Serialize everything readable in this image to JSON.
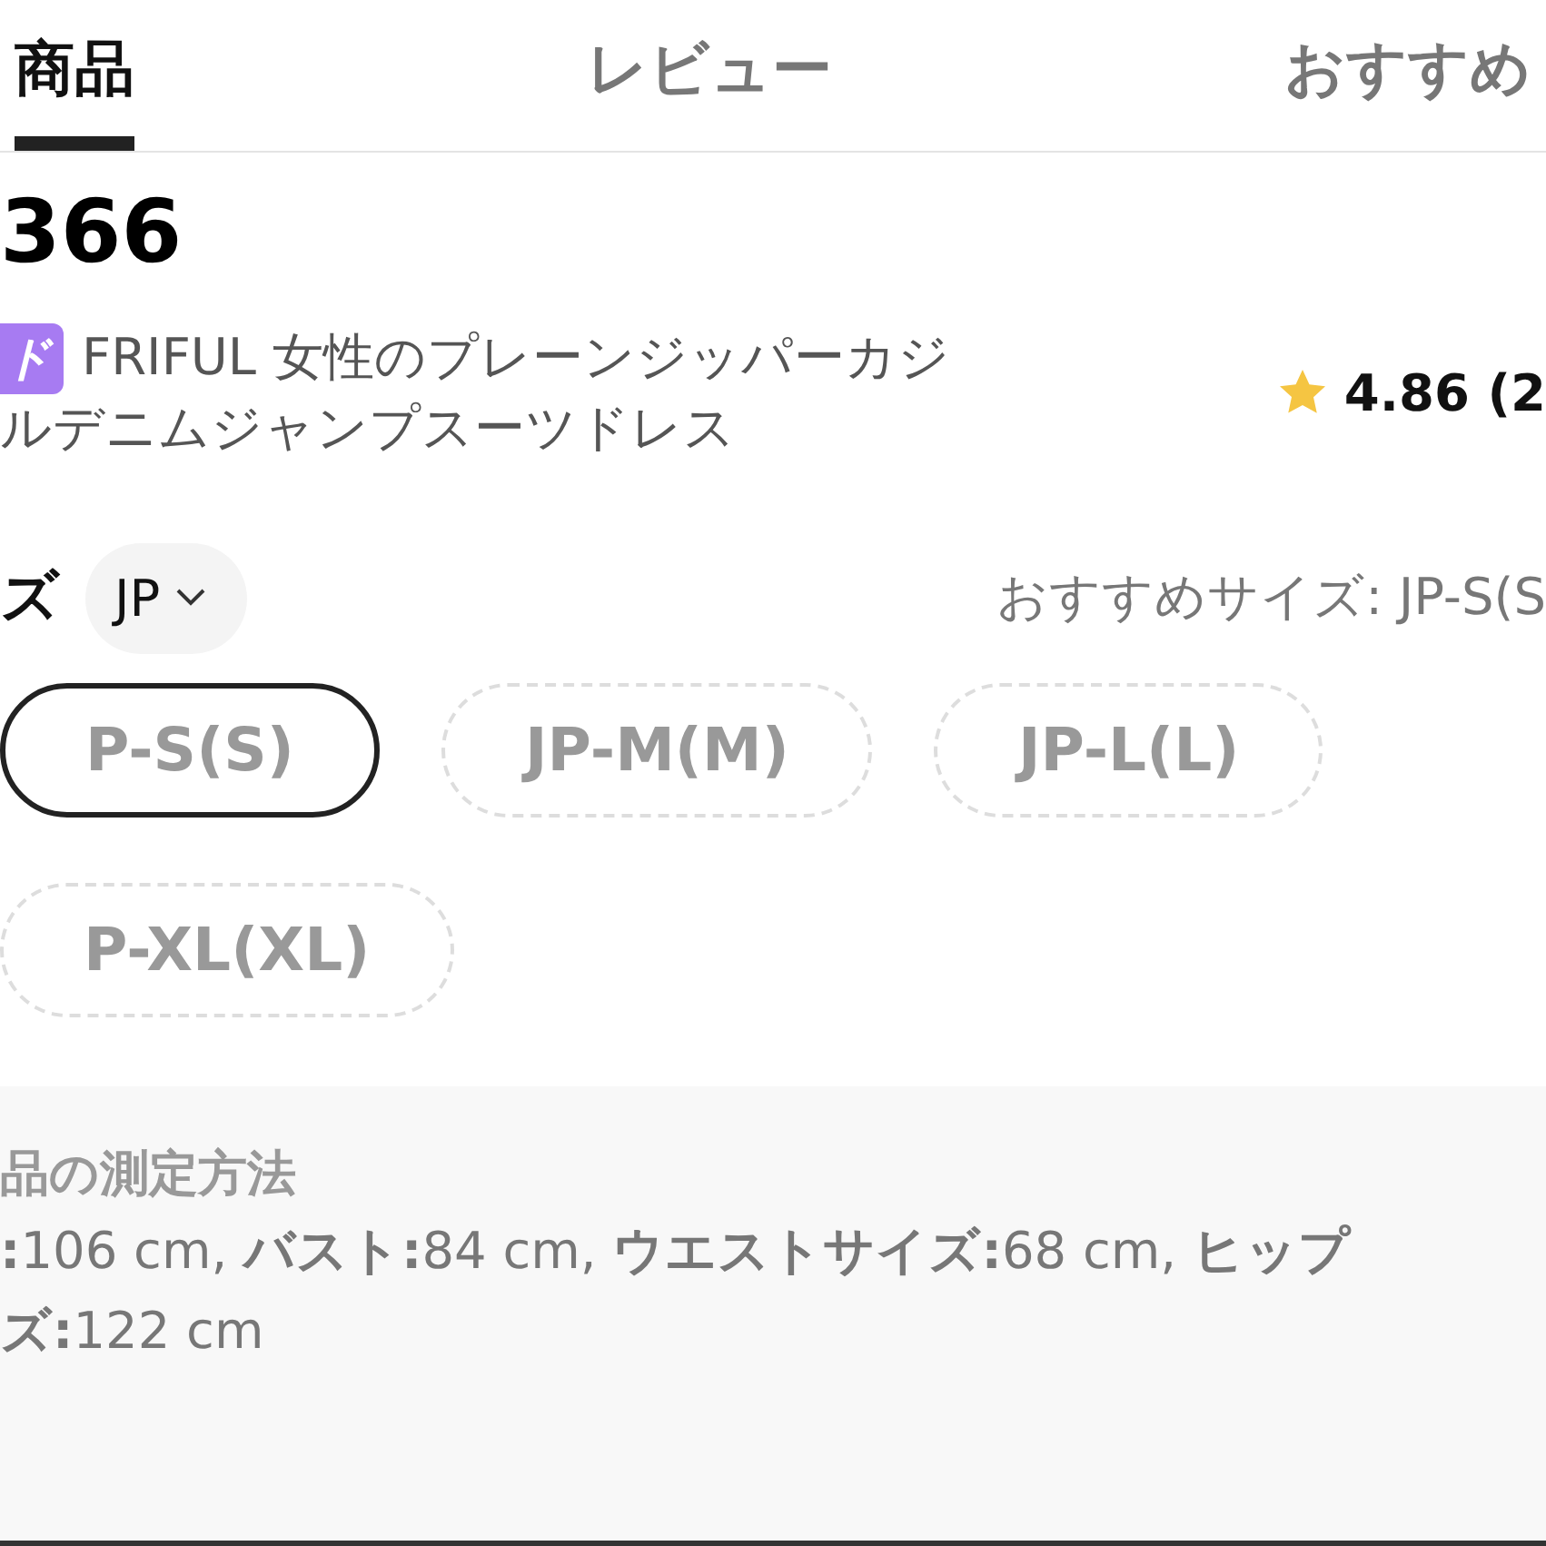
{
  "tabs": [
    {
      "label": "商品",
      "selected": true
    },
    {
      "label": "レビュー",
      "selected": false
    },
    {
      "label": "おすすめ",
      "selected": false
    }
  ],
  "price": "366",
  "product": {
    "badge": "ド",
    "title_lines": [
      "FRIFUL 女性のプレーンジッパーカジ",
      "ルデニムジャンプスーツドレス"
    ],
    "rating": "4.86 (2"
  },
  "size": {
    "label": "ズ",
    "region": "JP",
    "recommended": "おすすめサイズ: JP-S(S",
    "options": [
      {
        "label": "P-S(S)",
        "selected": true
      },
      {
        "label": "JP-M(M)",
        "selected": false
      },
      {
        "label": "JP-L(L)",
        "selected": false
      },
      {
        "label": "P-XL(XL)",
        "selected": false
      }
    ]
  },
  "measurement": {
    "title": "品の測定方法",
    "lines": [
      "**:**106 cm, **バスト:**84 cm, **ウエストサイズ:**68 cm, **ヒップ**",
      "**ズ:**122 cm"
    ]
  }
}
